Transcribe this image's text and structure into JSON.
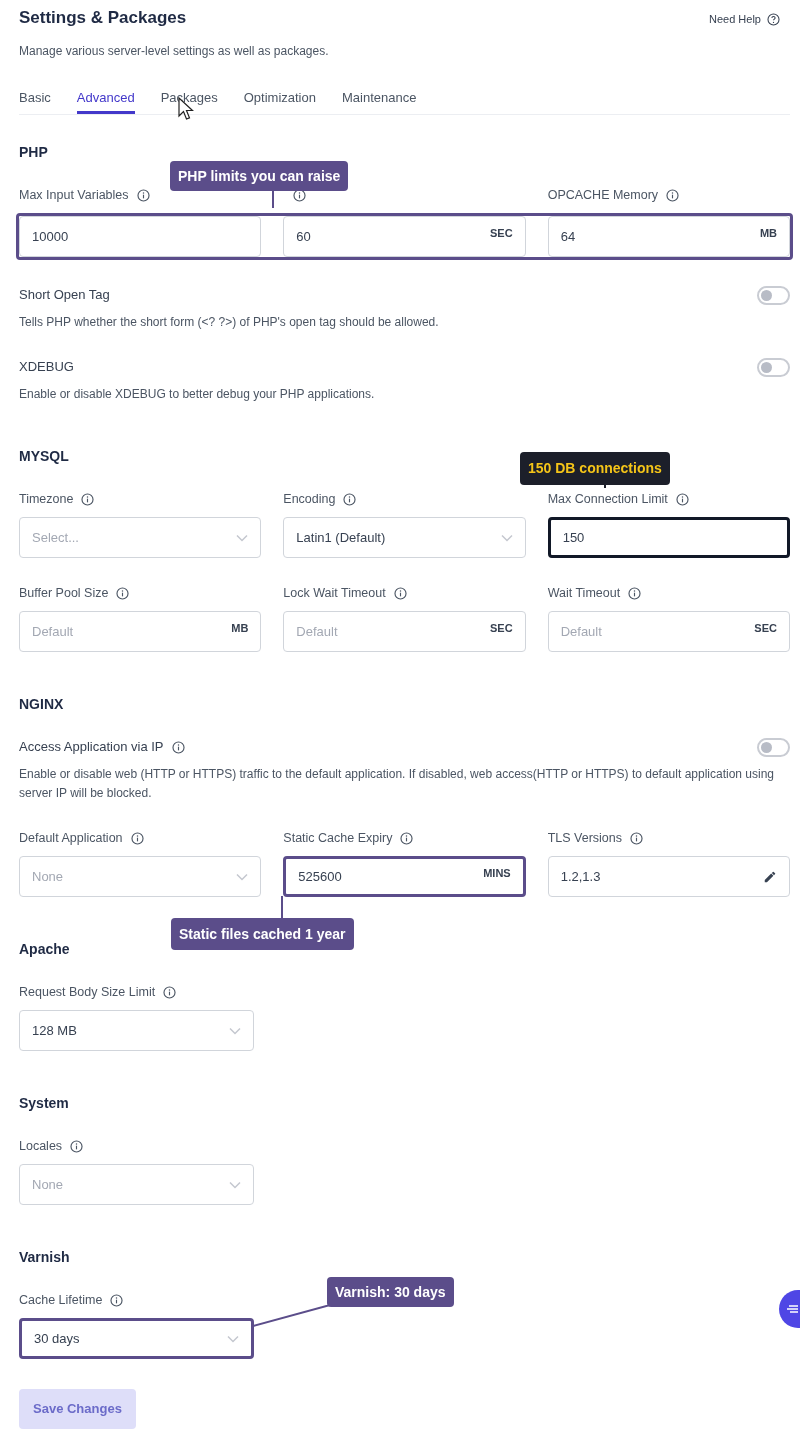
{
  "header": {
    "title": "Settings & Packages",
    "subtitle": "Manage various server-level settings as well as packages.",
    "help": "Need Help"
  },
  "tabs": [
    {
      "label": "Basic",
      "selected": false
    },
    {
      "label": "Advanced",
      "selected": true
    },
    {
      "label": "Packages",
      "selected": false
    },
    {
      "label": "Optimization",
      "selected": false
    },
    {
      "label": "Maintenance",
      "selected": false
    }
  ],
  "sections": [
    {
      "title": "PHP",
      "items": [
        {
          "kind": "fields",
          "highlight": {
            "color": "#5b4d8a"
          },
          "fields": [
            {
              "label": "Max Input Variables",
              "info": true,
              "kind": "input",
              "value": "10000"
            },
            {
              "info": true,
              "kind": "input",
              "value": "60",
              "unit": "SEC"
            },
            {
              "label": "OPCACHE Memory",
              "info": true,
              "kind": "input",
              "value": "64",
              "unit": "MB"
            }
          ]
        },
        {
          "kind": "toggle",
          "label": "Short Open Tag",
          "info": false,
          "on": false,
          "description": "Tells PHP whether the short form (<? ?>) of PHP's open tag should be allowed."
        },
        {
          "kind": "toggle",
          "label": "XDEBUG",
          "info": false,
          "on": false,
          "description": "Enable or disable XDEBUG to better debug your PHP applications."
        }
      ]
    },
    {
      "title": "MYSQL",
      "items": [
        {
          "kind": "fields",
          "fields": [
            {
              "label": "Timezone",
              "info": true,
              "kind": "select",
              "placeholder": "Select..."
            },
            {
              "label": "Encoding",
              "info": true,
              "kind": "select",
              "value": "Latin1 (Default)"
            },
            {
              "label": "Max Connection Limit",
              "info": true,
              "kind": "input",
              "value": "150",
              "highlight": {
                "color": "#111827"
              }
            }
          ]
        },
        {
          "kind": "fields",
          "fields": [
            {
              "label": "Buffer Pool Size",
              "info": true,
              "kind": "input",
              "placeholder": "Default",
              "unit": "MB"
            },
            {
              "label": "Lock Wait Timeout",
              "info": true,
              "kind": "input",
              "placeholder": "Default",
              "unit": "SEC"
            },
            {
              "label": "Wait Timeout",
              "info": true,
              "kind": "input",
              "placeholder": "Default",
              "unit": "SEC"
            }
          ]
        }
      ]
    },
    {
      "title": "NGINX",
      "items": [
        {
          "kind": "toggle",
          "label": "Access Application via IP",
          "info": true,
          "on": false,
          "description": "Enable or disable web (HTTP or HTTPS) traffic to the default application. If disabled, web access(HTTP or HTTPS) to default application using server IP will be blocked."
        },
        {
          "kind": "fields",
          "fields": [
            {
              "label": "Default Application",
              "info": true,
              "kind": "select",
              "placeholder": "None"
            },
            {
              "label": "Static Cache Expiry",
              "info": true,
              "kind": "input",
              "value": "525600",
              "unit": "MINS",
              "highlight": {
                "color": "#5b4d8a"
              }
            },
            {
              "label": "TLS Versions",
              "info": true,
              "kind": "edit",
              "value": "1.2,1.3"
            }
          ]
        }
      ]
    },
    {
      "title": "Apache",
      "items": [
        {
          "kind": "single",
          "fields": [
            {
              "label": "Request Body Size Limit",
              "info": true,
              "kind": "select",
              "value": "128 MB"
            }
          ]
        }
      ]
    },
    {
      "title": "System",
      "items": [
        {
          "kind": "single",
          "fields": [
            {
              "label": "Locales",
              "info": true,
              "kind": "select",
              "placeholder": "None"
            }
          ]
        }
      ]
    },
    {
      "title": "Varnish",
      "items": [
        {
          "kind": "single",
          "fields": [
            {
              "label": "Cache Lifetime",
              "info": true,
              "kind": "select",
              "value": "30 days",
              "highlight": {
                "color": "#5b4d8a"
              }
            }
          ]
        }
      ]
    }
  ],
  "save_button": {
    "label": "Save Changes",
    "disabled": true
  },
  "annotations": [
    {
      "text": "PHP limits you can raise",
      "color": "#5b4d8a"
    },
    {
      "text": "150 DB connections",
      "color": "#1c1f2a"
    },
    {
      "text": "Static files cached 1 year",
      "color": "#5b4d8a"
    },
    {
      "text": "Varnish: 30 days",
      "color": "#5b4d8a"
    }
  ]
}
